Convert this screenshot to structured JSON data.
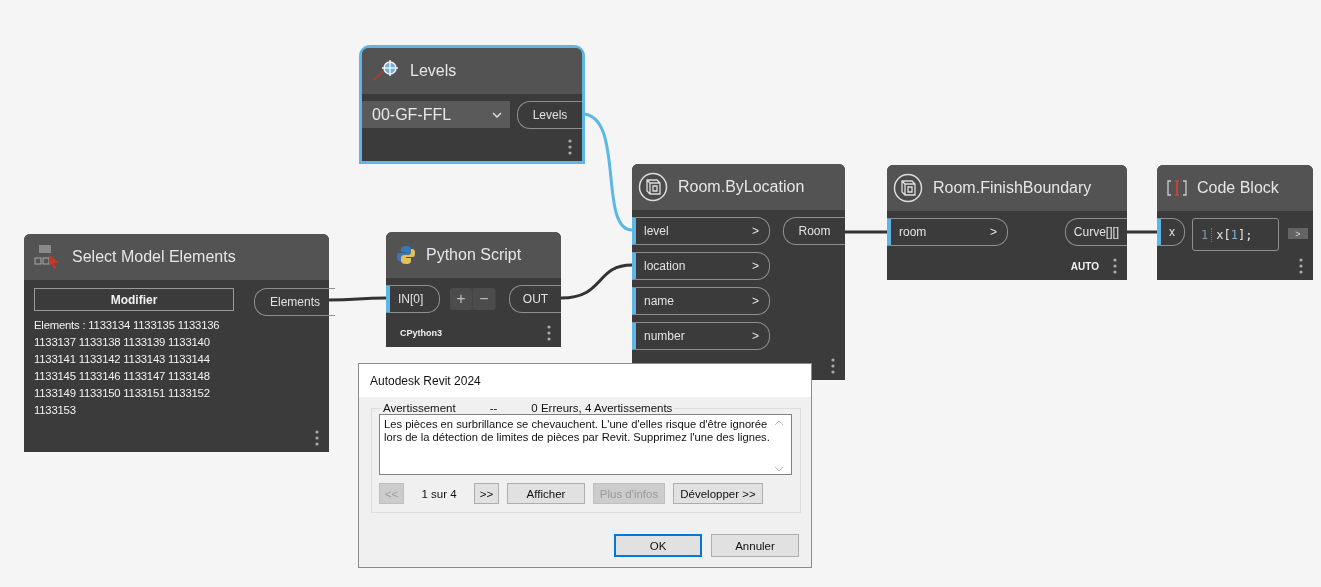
{
  "nodes": [
    {
      "kind": "select",
      "title": "Select Model Elements",
      "selected": false,
      "button": "Modifier",
      "outputs": [
        "Elements"
      ],
      "text": "Elements : 1133134 1133135 1133136 1133137 1133138 1133139 1133140 1133141 1133142 1133143 1133144 1133145 1133146 1133147 1133148 1133149 1133150 1133151 1133152 1133153"
    },
    {
      "kind": "dropdown",
      "title": "Levels",
      "selected": true,
      "value": "00-GF-FFL",
      "outputs": [
        "Levels"
      ]
    },
    {
      "kind": "python",
      "title": "Python Script",
      "selected": false,
      "inputs": [
        {
          "name": "IN[0]"
        }
      ],
      "add": "+",
      "remove": "−",
      "outputs": [
        "OUT"
      ],
      "engine": "CPython3"
    },
    {
      "kind": "function",
      "title": "Room.ByLocation",
      "selected": false,
      "inputs": [
        {
          "name": "level",
          "arrow": ">"
        },
        {
          "name": "location",
          "arrow": ">"
        },
        {
          "name": "name",
          "arrow": ">"
        },
        {
          "name": "number",
          "arrow": ">"
        }
      ],
      "outputs": [
        "Room"
      ]
    },
    {
      "kind": "function",
      "title": "Room.FinishBoundary",
      "selected": false,
      "inputs": [
        {
          "name": "room",
          "arrow": ">"
        }
      ],
      "outputs": [
        "Curve[][]"
      ],
      "lacing": "AUTO"
    },
    {
      "kind": "code",
      "title": "Code Block",
      "selected": false,
      "inputs": [
        {
          "name": "x"
        }
      ],
      "line_number": "1",
      "code": [
        {
          "kind": "plain",
          "text": "x["
        },
        {
          "kind": "number",
          "text": "1"
        },
        {
          "kind": "plain",
          "text": "];"
        }
      ],
      "output_arrow": ">"
    }
  ],
  "dialog": {
    "title": "Autodesk Revit 2024",
    "group_label": "Avertissement",
    "separator": "--",
    "summary": "0 Erreurs, 4 Avertissements",
    "message": "Les pièces en surbrillance se chevauchent. L'une d'elles risque d'être ignorée lors de la détection de limites de pièces par Revit. Supprimez l'une des lignes.",
    "prev": {
      "label": "<<",
      "disabled": true
    },
    "counter": "1 sur 4",
    "next": {
      "label": ">>",
      "disabled": false
    },
    "actions": [
      {
        "label": "Afficher",
        "disabled": false
      },
      {
        "label": "Plus d'infos",
        "disabled": true
      },
      {
        "label": "Développer >>",
        "disabled": false
      }
    ],
    "footer_buttons": [
      {
        "label": "OK",
        "default": true
      },
      {
        "label": "Annuler",
        "default": false
      }
    ]
  }
}
